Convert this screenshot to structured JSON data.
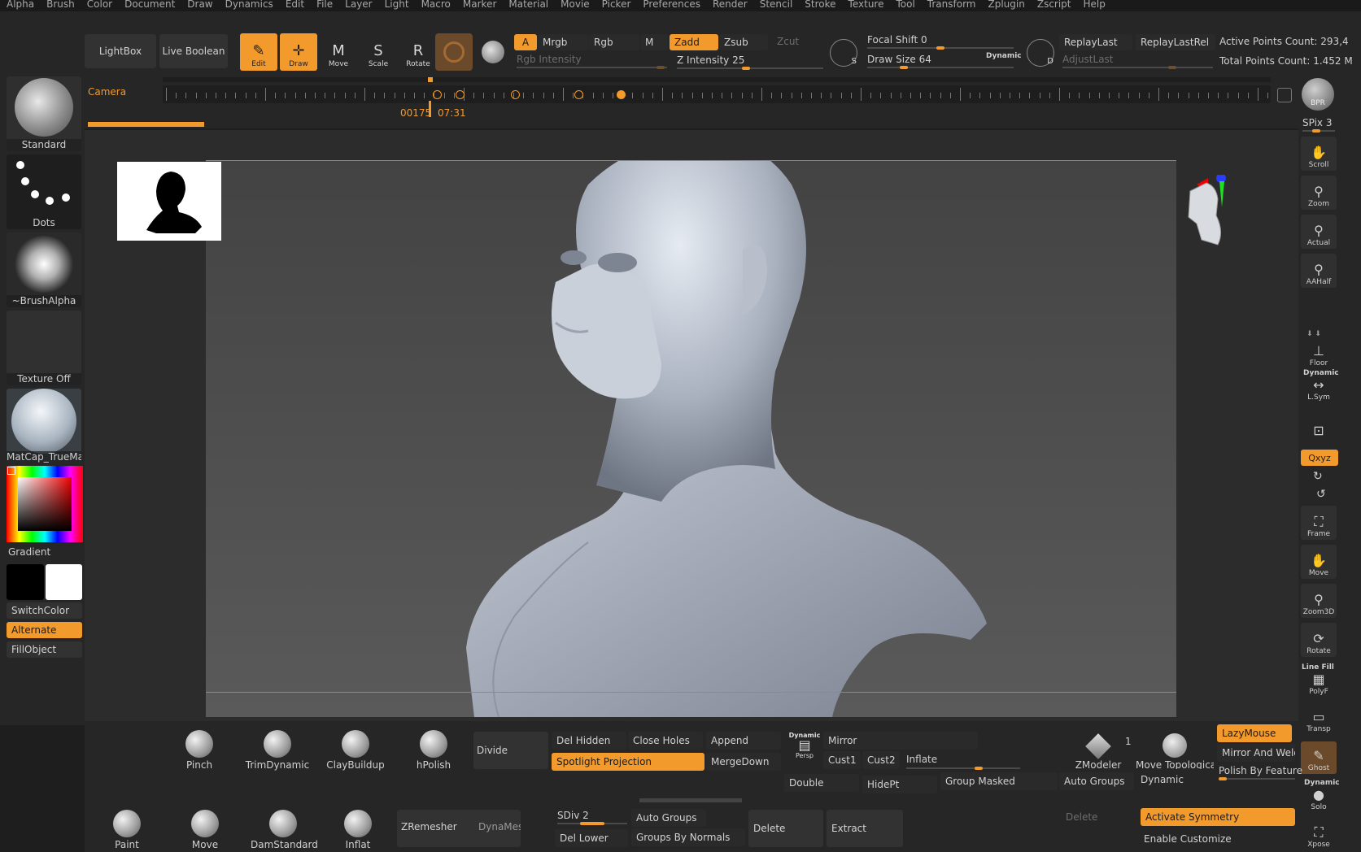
{
  "menu": [
    "Alpha",
    "Brush",
    "Color",
    "Document",
    "Draw",
    "Dynamics",
    "Edit",
    "File",
    "Layer",
    "Light",
    "Macro",
    "Marker",
    "Material",
    "Movie",
    "Picker",
    "Preferences",
    "Render",
    "Stencil",
    "Stroke",
    "Texture",
    "Tool",
    "Transform",
    "Zplugin",
    "Zscript",
    "Help"
  ],
  "top": {
    "lightbox": "LightBox",
    "live_boolean": "Live Boolean",
    "tools": [
      {
        "label": "Edit",
        "icon": "edit-icon",
        "glyph": "✎",
        "active": true
      },
      {
        "label": "Draw",
        "icon": "draw-icon",
        "glyph": "✛",
        "active": true
      },
      {
        "label": "Move",
        "icon": "move-icon",
        "glyph": "M",
        "active": false
      },
      {
        "label": "Scale",
        "icon": "scale-icon",
        "glyph": "S",
        "active": false
      },
      {
        "label": "Rotate",
        "icon": "rotate-icon",
        "glyph": "R",
        "active": false
      }
    ],
    "a": "A",
    "mrgb": "Mrgb",
    "rgb": "Rgb",
    "m": "M",
    "rgb_intensity": "Rgb Intensity",
    "zadd": "Zadd",
    "zsub": "Zsub",
    "zcut": "Zcut",
    "z_intensity": "Z Intensity 25",
    "focal_shift": "Focal Shift 0",
    "draw_size": "Draw Size 64",
    "dynamic": "Dynamic",
    "replay_last": "ReplayLast",
    "replay_last_rel": "ReplayLastRel",
    "adjust_last": "AdjustLast",
    "active_points": "Active Points Count: 293,4",
    "total_points": "Total Points Count: 1.452 M",
    "s_icon_label": "S",
    "d_icon_label": "D"
  },
  "timeline": {
    "label": "Camera",
    "frame": "00175",
    "time": "07:31"
  },
  "left": {
    "brush": "Standard",
    "stroke": "Dots",
    "alpha": "~BrushAlpha",
    "texture": "Texture Off",
    "material": "MatCap_TrueMa",
    "gradient": "Gradient",
    "switch_color": "SwitchColor",
    "alternate": "Alternate",
    "fill_object": "FillObject"
  },
  "right": {
    "bpr": "BPR",
    "spix": "SPix 3",
    "items": [
      {
        "label": "Scroll",
        "glyph": "✋",
        "icon": "scroll-icon"
      },
      {
        "label": "Zoom",
        "glyph": "⚲",
        "icon": "zoom-icon"
      },
      {
        "label": "Actual",
        "glyph": "⚲",
        "icon": "actual-icon"
      },
      {
        "label": "AAHalf",
        "glyph": "⚲",
        "icon": "aahalf-icon"
      }
    ],
    "floor": "Floor",
    "dynamic": "Dynamic",
    "lsym": "L.Sym",
    "xyz": "Qxyz",
    "items2": [
      {
        "label": "Frame",
        "glyph": "⛶",
        "icon": "frame-icon"
      },
      {
        "label": "Move",
        "glyph": "✋",
        "icon": "move-view-icon"
      },
      {
        "label": "Zoom3D",
        "glyph": "⚲",
        "icon": "zoom3d-icon"
      },
      {
        "label": "Rotate",
        "glyph": "⟳",
        "icon": "rotate-view-icon"
      }
    ],
    "line_fill": "Line Fill",
    "polyf": "PolyF",
    "transp": "Transp",
    "ghost": "Ghost",
    "dynamic2": "Dynamic",
    "solo": "Solo",
    "xpose": "Xpose"
  },
  "bottom": {
    "brushes_row1": [
      "Pinch",
      "TrimDynamic",
      "ClayBuildup",
      "hPolish"
    ],
    "brushes_row2": [
      "Paint",
      "Move",
      "DamStandard",
      "Inflat"
    ],
    "divide": "Divide",
    "del_hidden": "Del Hidden",
    "close_holes": "Close Holes",
    "append": "Append",
    "spotlight": "Spotlight Projection",
    "merge_down": "MergeDown",
    "dynamic_persp": "Dynamic",
    "persp": "Persp",
    "mirror": "Mirror",
    "cust1": "Cust1",
    "cust2": "Cust2",
    "inflate": "Inflate",
    "double": "Double",
    "hidept": "HidePt",
    "group_masked": "Group Masked",
    "auto_groups": "Auto Groups",
    "dynamic": "Dynamic",
    "zmodeler": "ZModeler",
    "zmodeler_num": "1",
    "move_topo": "Move Topologica",
    "lazymouse": "LazyMouse",
    "mirror_weld": "Mirror And Weld",
    "polish_feature": "Polish By Feature",
    "zremesher": "ZRemesher",
    "dynamesh": "DynaMesh",
    "sdiv": "SDiv 2",
    "del_lower": "Del Lower",
    "auto_groups2": "Auto Groups",
    "groups_normals": "Groups By Normals",
    "delete": "Delete",
    "extract": "Extract",
    "delete2": "Delete",
    "activate_symmetry": "Activate Symmetry",
    "enable_customize": "Enable Customize"
  }
}
